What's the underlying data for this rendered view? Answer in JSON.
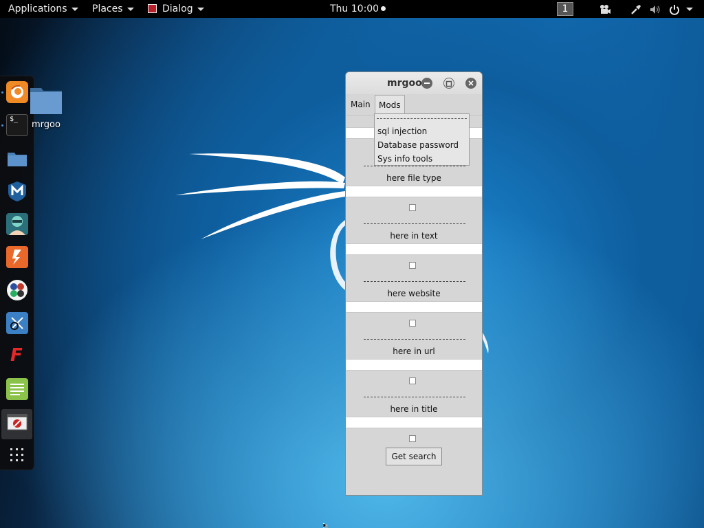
{
  "topbar": {
    "applications_label": "Applications",
    "places_label": "Places",
    "app_label": "Dialog",
    "clock": "Thu 10:00",
    "workspace": "1"
  },
  "dock": {
    "items": [
      {
        "name": "firefox",
        "icon": "firefox-icon"
      },
      {
        "name": "terminal",
        "icon": "terminal-icon",
        "glyph": "$_"
      },
      {
        "name": "files",
        "icon": "folder-icon"
      },
      {
        "name": "metasploit",
        "icon": "metasploit-icon",
        "glyph": "M"
      },
      {
        "name": "armitage",
        "icon": "armitage-icon"
      },
      {
        "name": "burpsuite",
        "icon": "burpsuite-icon"
      },
      {
        "name": "maltego",
        "icon": "maltego-icon"
      },
      {
        "name": "beef",
        "icon": "beef-icon"
      },
      {
        "name": "faraday",
        "icon": "faraday-icon",
        "glyph": "F"
      },
      {
        "name": "text-editor",
        "icon": "text-editor-icon"
      },
      {
        "name": "dialog",
        "icon": "dialog-app-icon"
      },
      {
        "name": "show-applications",
        "icon": "app-grid-icon"
      }
    ]
  },
  "desktop": {
    "folder_label": "mrgoo"
  },
  "window": {
    "title": "mrgoo",
    "menu": {
      "main": "Main",
      "mods": "Mods"
    },
    "fields": [
      {
        "label": "here file type"
      },
      {
        "label": "here in text"
      },
      {
        "label": "here website"
      },
      {
        "label": "here in url"
      },
      {
        "label": "here in title"
      }
    ],
    "button": "Get search"
  },
  "dropdown": {
    "items": [
      "sql injection",
      "Database password",
      "Sys info tools"
    ]
  },
  "colors": {
    "window_bg": "#d6d6d6",
    "topbar_bg": "#000000",
    "desktop_accent": "#1476c0"
  }
}
